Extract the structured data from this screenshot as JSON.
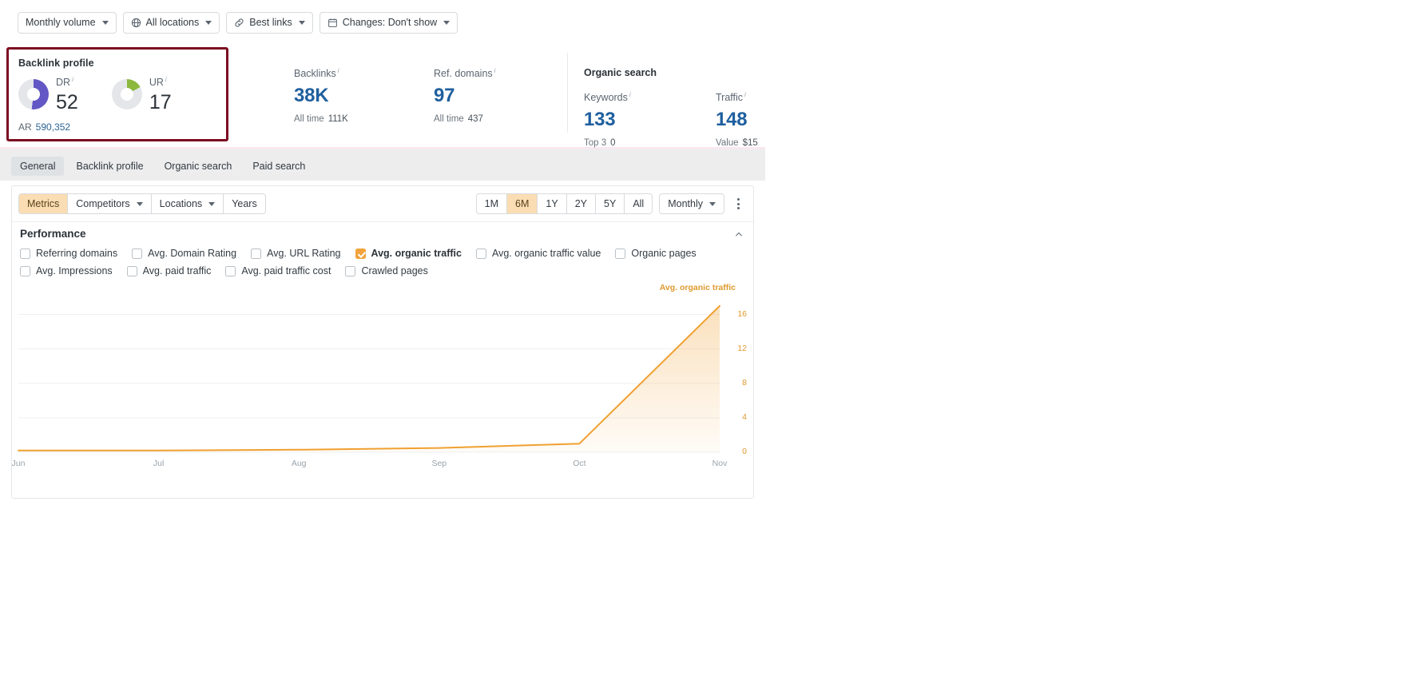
{
  "toolbar": {
    "filters": [
      {
        "label": "Monthly volume",
        "icon": "none",
        "caret": true
      },
      {
        "label": "All locations",
        "icon": "globe-icon",
        "caret": true
      },
      {
        "label": "Best links",
        "icon": "link-icon",
        "caret": true
      },
      {
        "label": "Changes: Don't show",
        "icon": "calendar-icon",
        "caret": true
      }
    ]
  },
  "backlink_card": {
    "title": "Backlink profile",
    "dr": {
      "label": "DR",
      "value": "52",
      "percent": 52,
      "color": "#6257c4"
    },
    "ur": {
      "label": "UR",
      "value": "17",
      "percent": 17,
      "color": "#8cb83d"
    },
    "ar": {
      "label": "AR",
      "value": "590,352"
    }
  },
  "metrics": [
    {
      "label": "Backlinks",
      "value": "38K",
      "sub_label": "All time",
      "sub_value": "111K"
    },
    {
      "label": "Ref. domains",
      "value": "97",
      "sub_label": "All time",
      "sub_value": "437"
    }
  ],
  "organic": {
    "title": "Organic search",
    "metrics": [
      {
        "label": "Keywords",
        "value": "133",
        "sub_label": "Top 3",
        "sub_value": "0"
      },
      {
        "label": "Traffic",
        "value": "148",
        "sub_label": "Value",
        "sub_value": "$15"
      }
    ]
  },
  "tabs": [
    {
      "label": "General",
      "active": true
    },
    {
      "label": "Backlink profile",
      "active": false
    },
    {
      "label": "Organic search",
      "active": false
    },
    {
      "label": "Paid search",
      "active": false
    }
  ],
  "panel_toolbar": {
    "left_segments": [
      {
        "label": "Metrics",
        "active": true,
        "caret": false
      },
      {
        "label": "Competitors",
        "active": false,
        "caret": true
      },
      {
        "label": "Locations",
        "active": false,
        "caret": true
      },
      {
        "label": "Years",
        "active": false,
        "caret": false
      }
    ],
    "ranges": [
      {
        "label": "1M",
        "active": false
      },
      {
        "label": "6M",
        "active": true
      },
      {
        "label": "1Y",
        "active": false
      },
      {
        "label": "2Y",
        "active": false
      },
      {
        "label": "5Y",
        "active": false
      },
      {
        "label": "All",
        "active": false
      }
    ],
    "granularity": {
      "label": "Monthly",
      "caret": true
    }
  },
  "performance": {
    "title": "Performance",
    "checkboxes_row1": [
      {
        "label": "Referring domains",
        "checked": false
      },
      {
        "label": "Avg. Domain Rating",
        "checked": false
      },
      {
        "label": "Avg. URL Rating",
        "checked": false
      },
      {
        "label": "Avg. organic traffic",
        "checked": true
      },
      {
        "label": "Avg. organic traffic value",
        "checked": false
      },
      {
        "label": "Organic pages",
        "checked": false
      }
    ],
    "checkboxes_row2": [
      {
        "label": "Avg. Impressions",
        "checked": false
      },
      {
        "label": "Avg. paid traffic",
        "checked": false
      },
      {
        "label": "Avg. paid traffic cost",
        "checked": false
      },
      {
        "label": "Crawled pages",
        "checked": false
      }
    ]
  },
  "chart_data": {
    "type": "area",
    "title": "",
    "series_label": "Avg. organic traffic",
    "series_color": "#f0a030",
    "categories": [
      "Jun",
      "Jul",
      "Aug",
      "Sep",
      "Oct",
      "Nov"
    ],
    "values": [
      0.2,
      0.2,
      0.3,
      0.5,
      1.0,
      17
    ],
    "ylabel": "",
    "xlabel": "",
    "ylim": [
      0,
      18
    ],
    "yticks": [
      0,
      4,
      8,
      12,
      16
    ],
    "grid": true,
    "legend_position": "top-right"
  }
}
